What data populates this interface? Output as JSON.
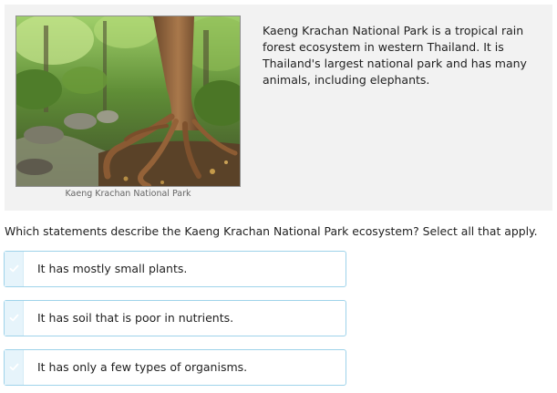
{
  "passage": {
    "image_alt": "Kaeng Krachan rain forest with large tree roots",
    "caption": "Kaeng Krachan National Park",
    "description": "Kaeng Krachan National Park is a tropical rain forest ecosystem in western Thailand. It is Thailand's largest national park and has many animals, including elephants."
  },
  "question": {
    "text": "Which statements describe the Kaeng Krachan National Park ecosystem? Select all that apply."
  },
  "choices": [
    {
      "label": "It has mostly small plants.",
      "selected": false
    },
    {
      "label": "It has soil that is poor in nutrients.",
      "selected": false
    },
    {
      "label": "It has only a few types of organisms.",
      "selected": false
    }
  ],
  "colors": {
    "card_background": "#f2f2f2",
    "choice_border": "#9fd3ea",
    "check_strip": "#e6f4fb",
    "check_mark": "#ffffff"
  }
}
